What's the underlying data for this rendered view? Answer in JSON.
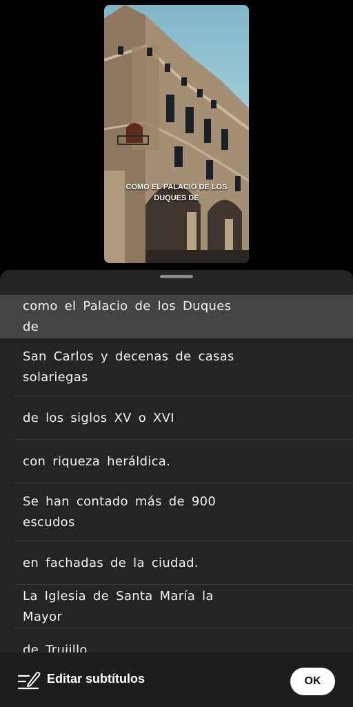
{
  "preview": {
    "caption": "COMO EL PALACIO DE LOS DUQUES DE"
  },
  "subtitles": [
    {
      "text": "como el Palacio de los Duques de",
      "selected": true
    },
    {
      "text": "San Carlos y decenas de casas solariegas",
      "selected": false
    },
    {
      "text": "de los siglos XV o XVI",
      "selected": false
    },
    {
      "text": "con riqueza heráldica.",
      "selected": false
    },
    {
      "text": "Se han contado más de 900 escudos",
      "selected": false
    },
    {
      "text": "en fachadas de la ciudad.",
      "selected": false
    },
    {
      "text": "La Iglesia de Santa María la Mayor",
      "selected": false
    },
    {
      "text": "de Trujillo",
      "selected": false
    }
  ],
  "footer": {
    "edit_label": "Editar subtítulos",
    "ok_label": "OK"
  },
  "colors": {
    "background": "#000000",
    "sheet": "#242424",
    "selected_row": "#444444",
    "footer": "#1d1d1d",
    "ok_button": "#ffffff"
  }
}
